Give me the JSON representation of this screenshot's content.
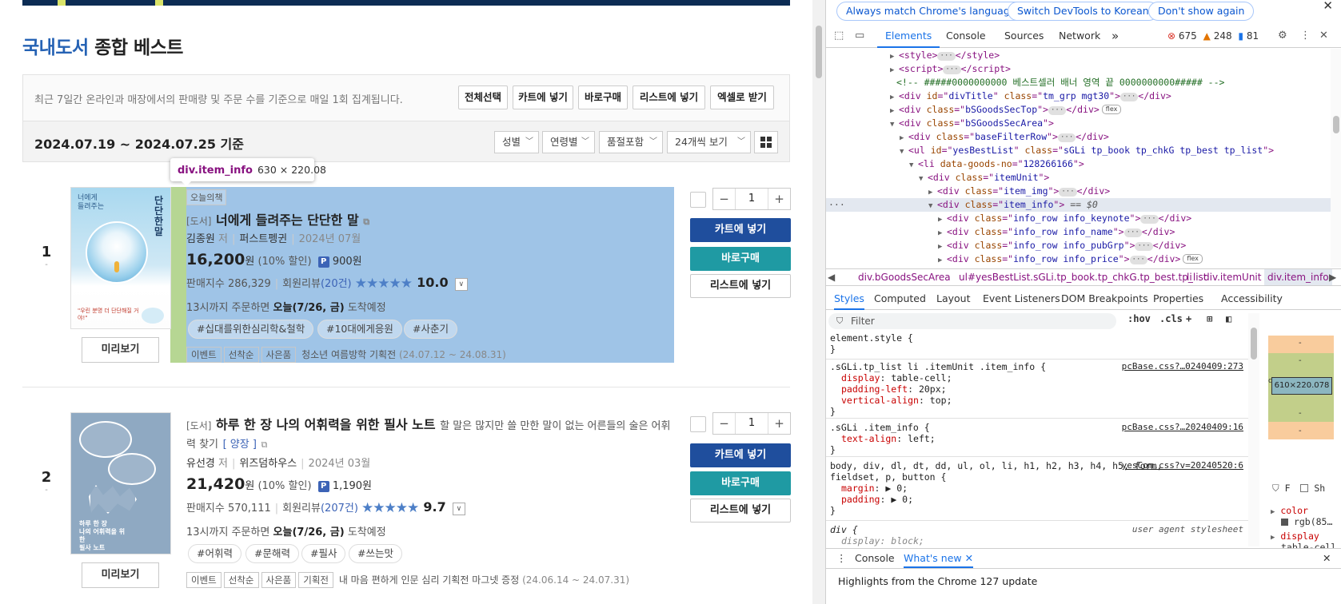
{
  "page": {
    "title_highlight": "국내도서",
    "title_rest": "종합 베스트",
    "description": "최근 7일간 온라인과 매장에서의 판매량 및 주문 수를 기준으로 매일 1회 집계됩니다.",
    "toolbar": {
      "select_all": "전체선택",
      "add_cart": "카트에 넣기",
      "buy_now": "바로구매",
      "add_list": "리스트에 넣기",
      "excel": "엑셀로 받기"
    },
    "date_range": "2024.07.19 ~ 2024.07.25 기준",
    "filters": {
      "gender": "성별",
      "age": "연령별",
      "stock": "품절포함",
      "view": "24개씩 보기"
    },
    "tooltip": {
      "selector": "div.item_info",
      "size": "630 × 220.08"
    },
    "items": [
      {
        "rank": "1",
        "rank_change": "-",
        "keynote": "오늘의책",
        "category": "[도서]",
        "title": "너에게 들려주는 단단한 말",
        "subtitle": "",
        "edition": "",
        "author": "김종원",
        "author_role": "저",
        "publisher": "퍼스트펭귄",
        "pub_date": "2024년 07월",
        "price": "16,200",
        "price_unit": "원",
        "discount": "(10% 할인)",
        "point_badge": "P",
        "points": "900원",
        "sales_label": "판매지수",
        "sales_index": "286,329",
        "review_label": "회원리뷰",
        "review_count": "(20건)",
        "stars_glyph": "★★★★★",
        "rating": "10.0",
        "delivery_prefix": "13시까지 주문하면",
        "delivery_date": "오늘(7/26, 금)",
        "delivery_suffix": "도착예정",
        "tags": [
          "#십대를위한심리학&철학",
          "#10대에게응원",
          "#사춘기"
        ],
        "event_badges": [
          "이벤트",
          "선착순",
          "사은품"
        ],
        "event_text": "청소년 여름방학 기획전",
        "event_date": "(24.07.12 ~ 24.08.31)",
        "cover": {
          "t1": "너에게",
          "t2": "들려주는",
          "big": "단단한 말",
          "quote": "\"우린 분명 더 단단해질 거야!\""
        },
        "qty": "1",
        "cart_label": "카트에 넣기",
        "buy_label": "바로구매",
        "list_label": "리스트에 넣기",
        "preview_label": "미리보기"
      },
      {
        "rank": "2",
        "rank_change": "-",
        "keynote": "",
        "category": "[도서]",
        "title": "하루 한 장 나의 어휘력을 위한 필사 노트",
        "subtitle": "할 말은 많지만 쓸 만한 말이 없는 어른들의 술은 어휘력 찾기",
        "edition": "[ 양장 ]",
        "author": "유선경",
        "author_role": "저",
        "publisher": "위즈덤하우스",
        "pub_date": "2024년 03월",
        "price": "21,420",
        "price_unit": "원",
        "discount": "(10% 할인)",
        "point_badge": "P",
        "points": "1,190원",
        "sales_label": "판매지수",
        "sales_index": "570,111",
        "review_label": "회원리뷰",
        "review_count": "(207건)",
        "stars_glyph": "★★★★★",
        "rating": "9.7",
        "delivery_prefix": "13시까지 주문하면",
        "delivery_date": "오늘(7/26, 금)",
        "delivery_suffix": "도착예정",
        "tags": [
          "#어휘력",
          "#문해력",
          "#필사",
          "#쓰는맛"
        ],
        "event_badges": [
          "이벤트",
          "선착순",
          "사은품",
          "기획전"
        ],
        "event_text": "내 마음 편하게 인문 심리 기획전 마그넷 증정",
        "event_date": "(24.06.14 ~ 24.07.31)",
        "cover": {
          "t1": "하루 한 장",
          "t2": "나의 어휘력을 위한",
          "big": "필사 노트",
          "quote": "..."
        },
        "qty": "1",
        "cart_label": "카트에 넣기",
        "buy_label": "바로구매",
        "list_label": "리스트에 넣기",
        "preview_label": "미리보기"
      }
    ]
  },
  "devtools": {
    "notice": {
      "match_language": "Always match Chrome's language",
      "switch_korean": "Switch DevTools to Korean",
      "dont_show": "Don't show again"
    },
    "tabs": [
      "Elements",
      "Console",
      "Sources",
      "Network"
    ],
    "active_tab": "Elements",
    "more_tabs": "»",
    "issues": {
      "errors": "675",
      "warnings": "248",
      "info": "81"
    },
    "breadcrumbs": [
      "div.bGoodsSecArea",
      "ul#yesBestList.sGLi.tp_book.tp_chkG.tp_best.tp_list",
      "li",
      "div.itemUnit",
      "div.item_info"
    ],
    "styles_tabs": [
      "Styles",
      "Computed",
      "Layout",
      "Event Listeners",
      "DOM Breakpoints",
      "Properties",
      "Accessibility"
    ],
    "filter_placeholder": "Filter",
    "hov": ":hov",
    "cls": ".cls",
    "box_content_size": "610×220.078",
    "box_padding_label": "dding",
    "computed_filter": "F",
    "computed_show": "Sh",
    "computed_props": [
      "color",
      "rgb(85…",
      "display",
      "table-cell"
    ],
    "drawer_tabs": [
      "Console",
      "What's new"
    ],
    "drawer_message": "Highlights from the Chrome 127 update"
  }
}
